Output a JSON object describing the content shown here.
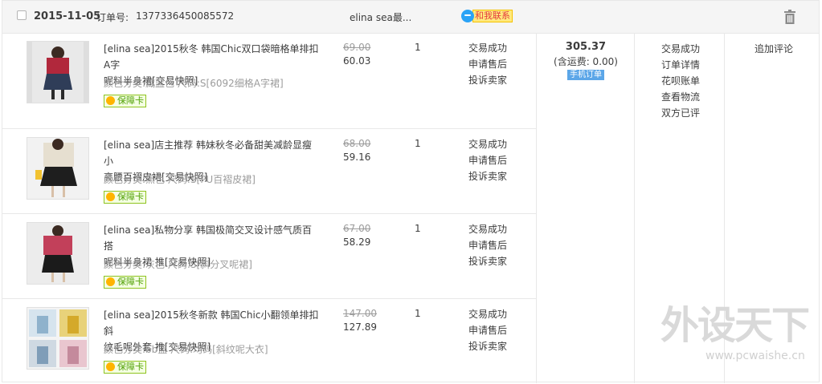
{
  "order": {
    "date": "2015-11-05",
    "order_no_label": "订单号:",
    "order_no": "1377336450085572",
    "shop": "elina sea最...",
    "contact_label": "和我联系",
    "total": "305.37",
    "shipping": "(含运费: 0.00)",
    "mobile_tag": "手机订单",
    "status_links": [
      "交易成功",
      "订单详情",
      "花呗账单",
      "查看物流",
      "双方已评"
    ],
    "review_link": "追加评论"
  },
  "items": [
    {
      "title_line1": "[elina sea]2015秋冬 韩国Chic双口袋暗格单排扣A字",
      "title_line2": "呢料半身裙[交易快照]",
      "attrs": "颜色分类:藏蓝色 尺码:S[6092细格A字裙]",
      "badge": "保障卡",
      "orig_price": "69.00",
      "price": "60.03",
      "qty": "1",
      "svc": [
        "交易成功",
        "申请售后",
        "投诉卖家"
      ]
    },
    {
      "title_line1": "[elina sea]店主推荐 韩妹秋冬必备甜美减龄显瘦小",
      "title_line2": "高腰百褶皮裙[交易快照]",
      "attrs": "颜色分类:黑色 尺码:S[PU百褶皮裙]",
      "badge": "保障卡",
      "orig_price": "68.00",
      "price": "59.16",
      "qty": "1",
      "svc": [
        "交易成功",
        "申请售后",
        "投诉卖家"
      ]
    },
    {
      "title_line1": "[elina sea]私物分享 韩国极简交叉设计感气质百搭",
      "title_line2": "呢料半身裙 推[交易快照]",
      "attrs": "颜色分类:灰色 尺码:S[斜分叉呢裙]",
      "badge": "保障卡",
      "orig_price": "67.00",
      "price": "58.29",
      "qty": "1",
      "svc": [
        "交易成功",
        "申请售后",
        "投诉卖家"
      ]
    },
    {
      "title_line1": "[elina sea]2015秋冬新款 韩国Chic小翻领单排扣斜",
      "title_line2": "纹毛呢外套 推[交易快照]",
      "attrs": "颜色分类:bb蓝 尺码:均码[斜纹呢大衣]",
      "badge": "保障卡",
      "orig_price": "147.00",
      "price": "127.89",
      "qty": "1",
      "svc": [
        "交易成功",
        "申请售后",
        "投诉卖家"
      ]
    }
  ],
  "watermark": {
    "text": "外设天下",
    "url": "www.pcwaishe.cn"
  }
}
